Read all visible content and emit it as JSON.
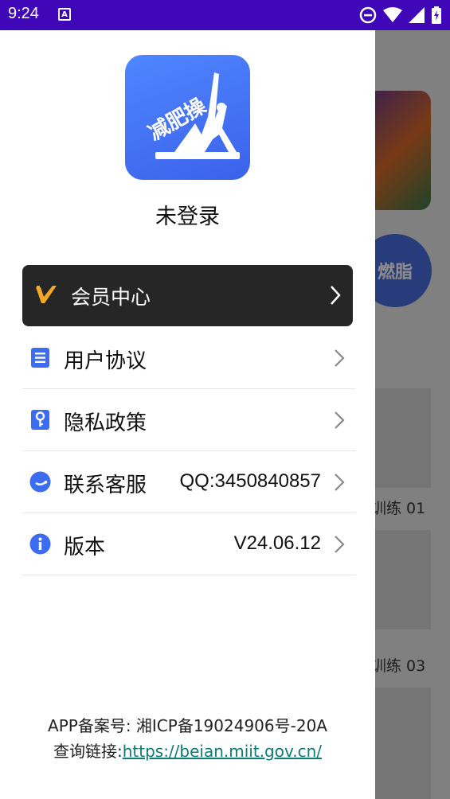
{
  "status_bar": {
    "time": "9:24",
    "notification_icon": "A"
  },
  "background": {
    "circle_text": "燃脂",
    "label_1": "训练 01",
    "label_2": "训练 03"
  },
  "drawer": {
    "logo_text": "减肥操",
    "login_status": "未登录",
    "vip": {
      "label": "会员中心"
    },
    "menu": [
      {
        "label": "用户协议",
        "value": "",
        "icon": "document-icon"
      },
      {
        "label": "隐私政策",
        "value": "",
        "icon": "privacy-key-icon"
      },
      {
        "label": "联系客服",
        "value": "QQ:3450840857",
        "icon": "service-icon"
      },
      {
        "label": "版本",
        "value": "V24.06.12",
        "icon": "info-icon"
      }
    ],
    "footer": {
      "filing": "APP备案号: 湘ICP备19024906号-20A",
      "query_prefix": "查询链接:",
      "query_link": "https://beian.miit.gov.cn/"
    }
  },
  "colors": {
    "status_bar": "#3f07b7",
    "accent": "#3b6cf2",
    "vip_card": "#262626",
    "vip_icon": "#f5a623",
    "link": "#0d7c74"
  }
}
